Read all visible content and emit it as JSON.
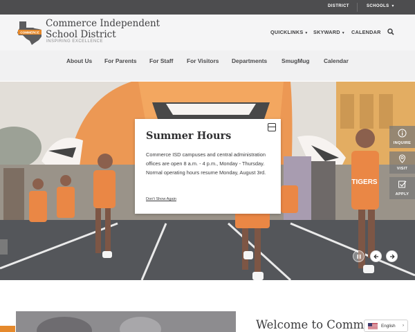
{
  "topbar": {
    "district_link": "DISTRICT",
    "schools_link": "SCHOOLS"
  },
  "header": {
    "site_name": "Commerce Independent School District",
    "tagline": "INSPIRING EXCELLENCE",
    "logo_text": "COMMERCE",
    "nav": {
      "quicklinks": "QUICKLINKS",
      "skyward": "SKYWARD",
      "calendar": "CALENDAR"
    }
  },
  "main_nav": {
    "items": [
      "About Us",
      "For Parents",
      "For Staff",
      "For Visitors",
      "Departments",
      "SmugMug",
      "Calendar"
    ]
  },
  "hero": {
    "jersey_text": "TIGERS"
  },
  "modal": {
    "title": "Summer Hours",
    "body": "Commerce ISD campuses and central administration offices are open 8 a.m. - 4 p.m., Monday - Thursday. Normal operating hours resume Monday, August 3rd.",
    "dismiss_link": "Don't Show Again"
  },
  "side_actions": {
    "inquire": "INQUIRE",
    "visit": "VISIT",
    "apply": "APPLY"
  },
  "lower": {
    "welcome": "Welcome to Commerce",
    "language": "English"
  },
  "colors": {
    "topbar": "#4d4d4f",
    "accent_orange": "#e5892c",
    "header_bg": "#f5f5f6"
  }
}
